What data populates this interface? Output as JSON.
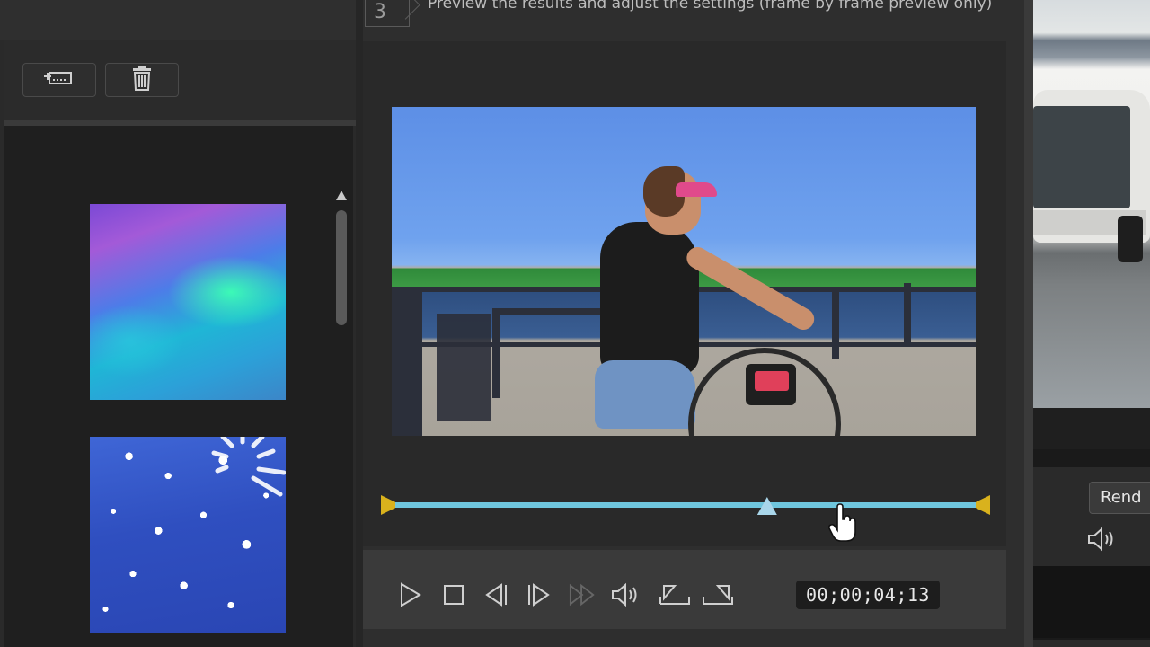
{
  "step": {
    "number": "3",
    "text": "Preview the results and adjust the settings (frame by frame preview only)"
  },
  "left_toolbar": {
    "buttons": [
      {
        "icon": "add-frame-icon"
      },
      {
        "icon": "trash-icon"
      }
    ]
  },
  "left_list": {
    "items": [
      {
        "name": "aurora-thumbnail"
      },
      {
        "name": "clouds-thumbnail"
      }
    ],
    "loading": true
  },
  "preview": {
    "slider_position": 0.64
  },
  "transport": {
    "buttons": [
      "play-icon",
      "stop-icon",
      "previous-frame-icon",
      "next-frame-icon",
      "fast-forward-icon",
      "volume-icon",
      "mark-in-icon",
      "mark-out-icon"
    ],
    "timecode": "00;00;04;13"
  },
  "right_panel": {
    "render_label": "Rend"
  }
}
